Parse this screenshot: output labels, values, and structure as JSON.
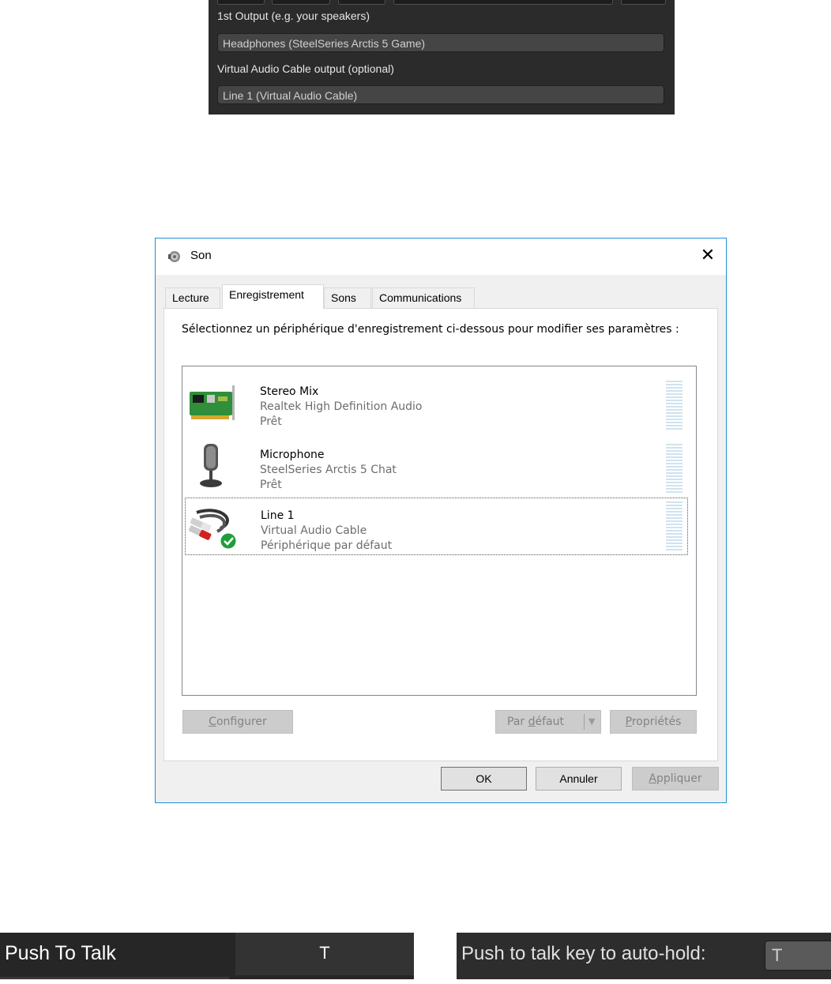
{
  "audio_panel": {
    "output1_label": "1st Output (e.g. your speakers)",
    "output1_value": "Headphones (SteelSeries Arctis 5 Game)",
    "vac_label": "Virtual Audio Cable output (optional)",
    "vac_value": "Line 1 (Virtual Audio Cable)"
  },
  "dialog": {
    "title": "Son",
    "close_glyph": "✕",
    "tabs": [
      {
        "label": "Lecture"
      },
      {
        "label": "Enregistrement"
      },
      {
        "label": "Sons"
      },
      {
        "label": "Communications"
      }
    ],
    "active_tab": "Enregistrement",
    "instruction": "Sélectionnez un périphérique d'enregistrement ci-dessous pour modifier ses paramètres :",
    "devices": [
      {
        "name": "Stereo Mix",
        "subtitle": "Realtek High Definition Audio",
        "status": "Prêt",
        "icon": "sound-card-icon"
      },
      {
        "name": "Microphone",
        "subtitle": "SteelSeries Arctis 5 Chat",
        "status": "Prêt",
        "icon": "microphone-icon"
      },
      {
        "name": "Line 1",
        "subtitle": "Virtual Audio Cable",
        "status": "Périphérique par défaut",
        "icon": "rca-cable-icon",
        "selected": true
      }
    ],
    "buttons": {
      "configure_u": "C",
      "configure_rest": "onfigurer",
      "default_pre": "Par ",
      "default_u": "d",
      "default_rest": "éfaut",
      "properties_u": "P",
      "properties_rest": "ropriétés",
      "ok": "OK",
      "cancel": "Annuler",
      "apply_u": "A",
      "apply_rest": "ppliquer"
    }
  },
  "keybind_left": {
    "label": "Push To Talk",
    "key": "T"
  },
  "keybind_right": {
    "label": "Push to talk key to auto-hold:",
    "key": "T"
  },
  "colors": {
    "dialog_border": "#1e90d6",
    "dark_panel": "#2b2b2b",
    "check_green": "#1f9d3a"
  }
}
